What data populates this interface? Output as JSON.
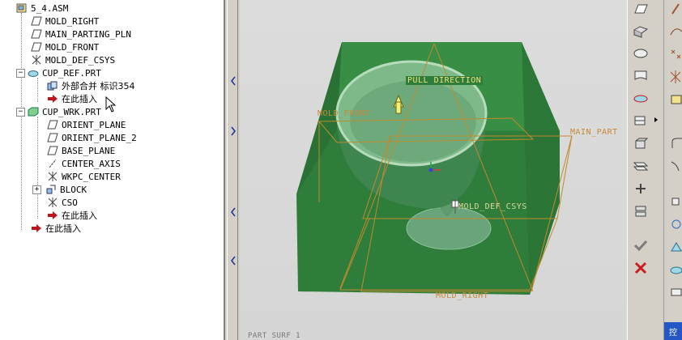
{
  "tree": {
    "items": [
      {
        "label": "5_4.ASM"
      },
      {
        "label": "MOLD_RIGHT"
      },
      {
        "label": "MAIN_PARTING_PLN"
      },
      {
        "label": "MOLD_FRONT"
      },
      {
        "label": "MOLD_DEF_CSYS"
      },
      {
        "label": "CUP_REF.PRT"
      },
      {
        "label": "外部合并 标识354"
      },
      {
        "label": "在此插入"
      },
      {
        "label": "CUP_WRK.PRT"
      },
      {
        "label": "ORIENT_PLANE"
      },
      {
        "label": "ORIENT_PLANE_2"
      },
      {
        "label": "BASE_PLANE"
      },
      {
        "label": "CENTER_AXIS"
      },
      {
        "label": "WKPC_CENTER"
      },
      {
        "label": "BLOCK"
      },
      {
        "label": "CSO"
      },
      {
        "label": "在此插入"
      },
      {
        "label": "在此插入"
      }
    ]
  },
  "viewport": {
    "pull_direction": "PULL DIRECTION",
    "mold_front": "MOLD_FRONT",
    "main_parting": "MAIN_PART",
    "mold_def_csys": "MOLD_DEF_CSYS",
    "mold_right": "MOLD_RIGHT",
    "status_text": "PART SURF 1"
  },
  "toolbar": {
    "confirm_icon": "checkmark-icon",
    "cancel_icon": "cross-icon",
    "bottom_button": "控"
  },
  "colors": {
    "block_green": "#2f7d3a",
    "datum_orange": "#c08a2c",
    "cancel_red": "#c81e1e"
  }
}
